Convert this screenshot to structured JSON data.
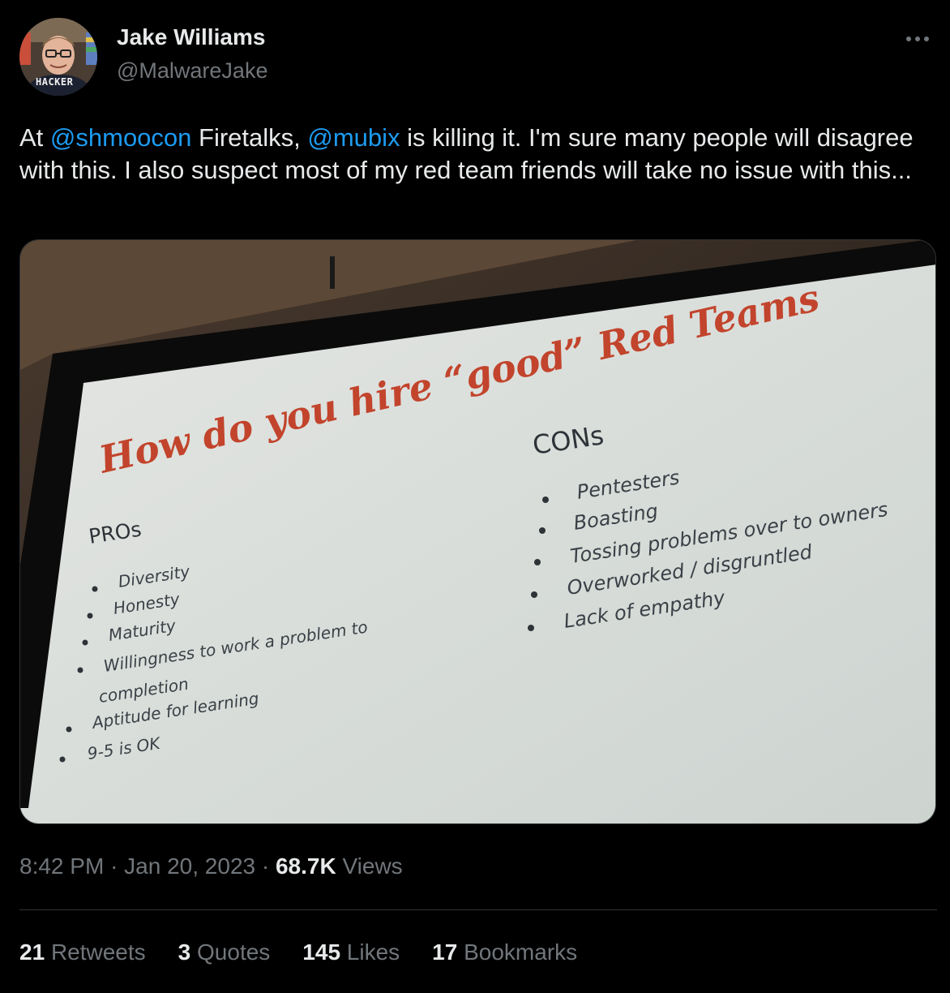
{
  "author": {
    "display_name": "Jake Williams",
    "handle": "@MalwareJake",
    "avatar_text": "HACKER"
  },
  "tweet": {
    "text_parts": [
      {
        "type": "text",
        "value": "At "
      },
      {
        "type": "mention",
        "value": "@shmoocon"
      },
      {
        "type": "text",
        "value": " Firetalks, "
      },
      {
        "type": "mention",
        "value": "@mubix"
      },
      {
        "type": "text",
        "value": " is killing it. I'm sure many people will disagree with this. I also suspect most of my red team friends will take no issue with this..."
      }
    ]
  },
  "slide": {
    "title": "How do you hire “good” Red Teams",
    "pros_heading": "PROs",
    "pros": [
      "Diversity",
      "Honesty",
      "Maturity",
      "Willingness to work a problem to",
      "completion",
      "Aptitude for learning",
      "9-5 is OK"
    ],
    "cons_heading": "CONs",
    "cons": [
      "Pentesters",
      "Boasting",
      "Tossing problems over to owners",
      "Overworked / disgruntled",
      "Lack of empathy"
    ]
  },
  "meta": {
    "time": "8:42 PM",
    "separator": "·",
    "date": "Jan 20, 2023",
    "views_count": "68.7K",
    "views_label": "Views"
  },
  "stats": {
    "retweets": {
      "count": "21",
      "label": "Retweets"
    },
    "quotes": {
      "count": "3",
      "label": "Quotes"
    },
    "likes": {
      "count": "145",
      "label": "Likes"
    },
    "bookmarks": {
      "count": "17",
      "label": "Bookmarks"
    }
  },
  "colors": {
    "background": "#000000",
    "text": "#e7e9ea",
    "secondary": "#71767b",
    "link": "#1d9bf0",
    "slide_title": "#c2442c",
    "slide_background": "#d9dedb"
  },
  "icons": {
    "more": "more-horizontal-icon"
  }
}
